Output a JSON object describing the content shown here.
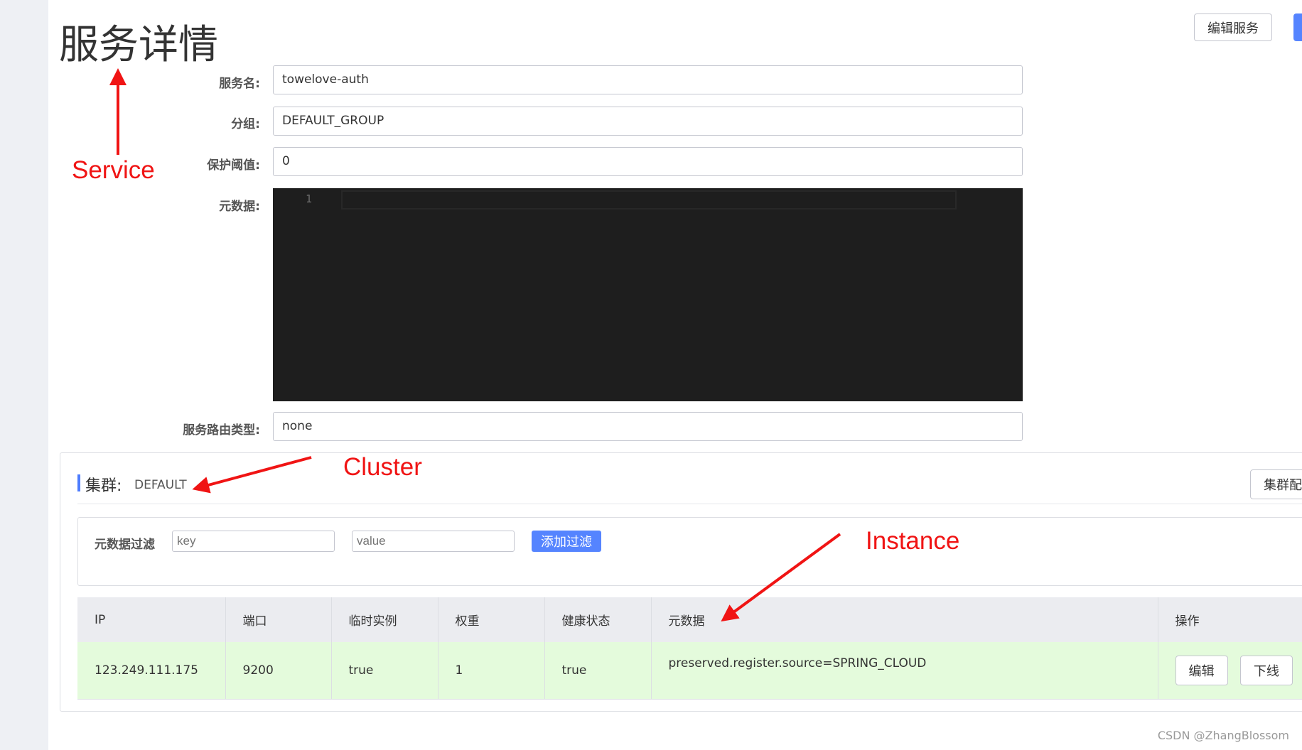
{
  "page": {
    "title": "服务详情",
    "edit_service": "编辑服务"
  },
  "form": {
    "service_name_label": "服务名:",
    "service_name": "towelove-auth",
    "group_label": "分组:",
    "group": "DEFAULT_GROUP",
    "threshold_label": "保护阈值:",
    "threshold": "0",
    "metadata_label": "元数据:",
    "editor_line": "1",
    "route_label": "服务路由类型:",
    "route": "none"
  },
  "cluster": {
    "label": "集群:",
    "name": "DEFAULT",
    "config_button": "集群配"
  },
  "filter": {
    "label": "元数据过滤",
    "key_placeholder": "key",
    "value_placeholder": "value",
    "add_button": "添加过滤"
  },
  "table": {
    "headers": [
      "IP",
      "端口",
      "临时实例",
      "权重",
      "健康状态",
      "元数据",
      "操作"
    ],
    "rows": [
      {
        "ip": "123.249.111.175",
        "port": "9200",
        "ephemeral": "true",
        "weight": "1",
        "healthy": "true",
        "metadata": "preserved.register.source=SPRING_CLOUD",
        "edit": "编辑",
        "offline": "下线"
      }
    ]
  },
  "annotations": {
    "service": "Service",
    "cluster": "Cluster",
    "instance": "Instance",
    "color": "#f01414"
  },
  "watermark": "CSDN @ZhangBlossom"
}
